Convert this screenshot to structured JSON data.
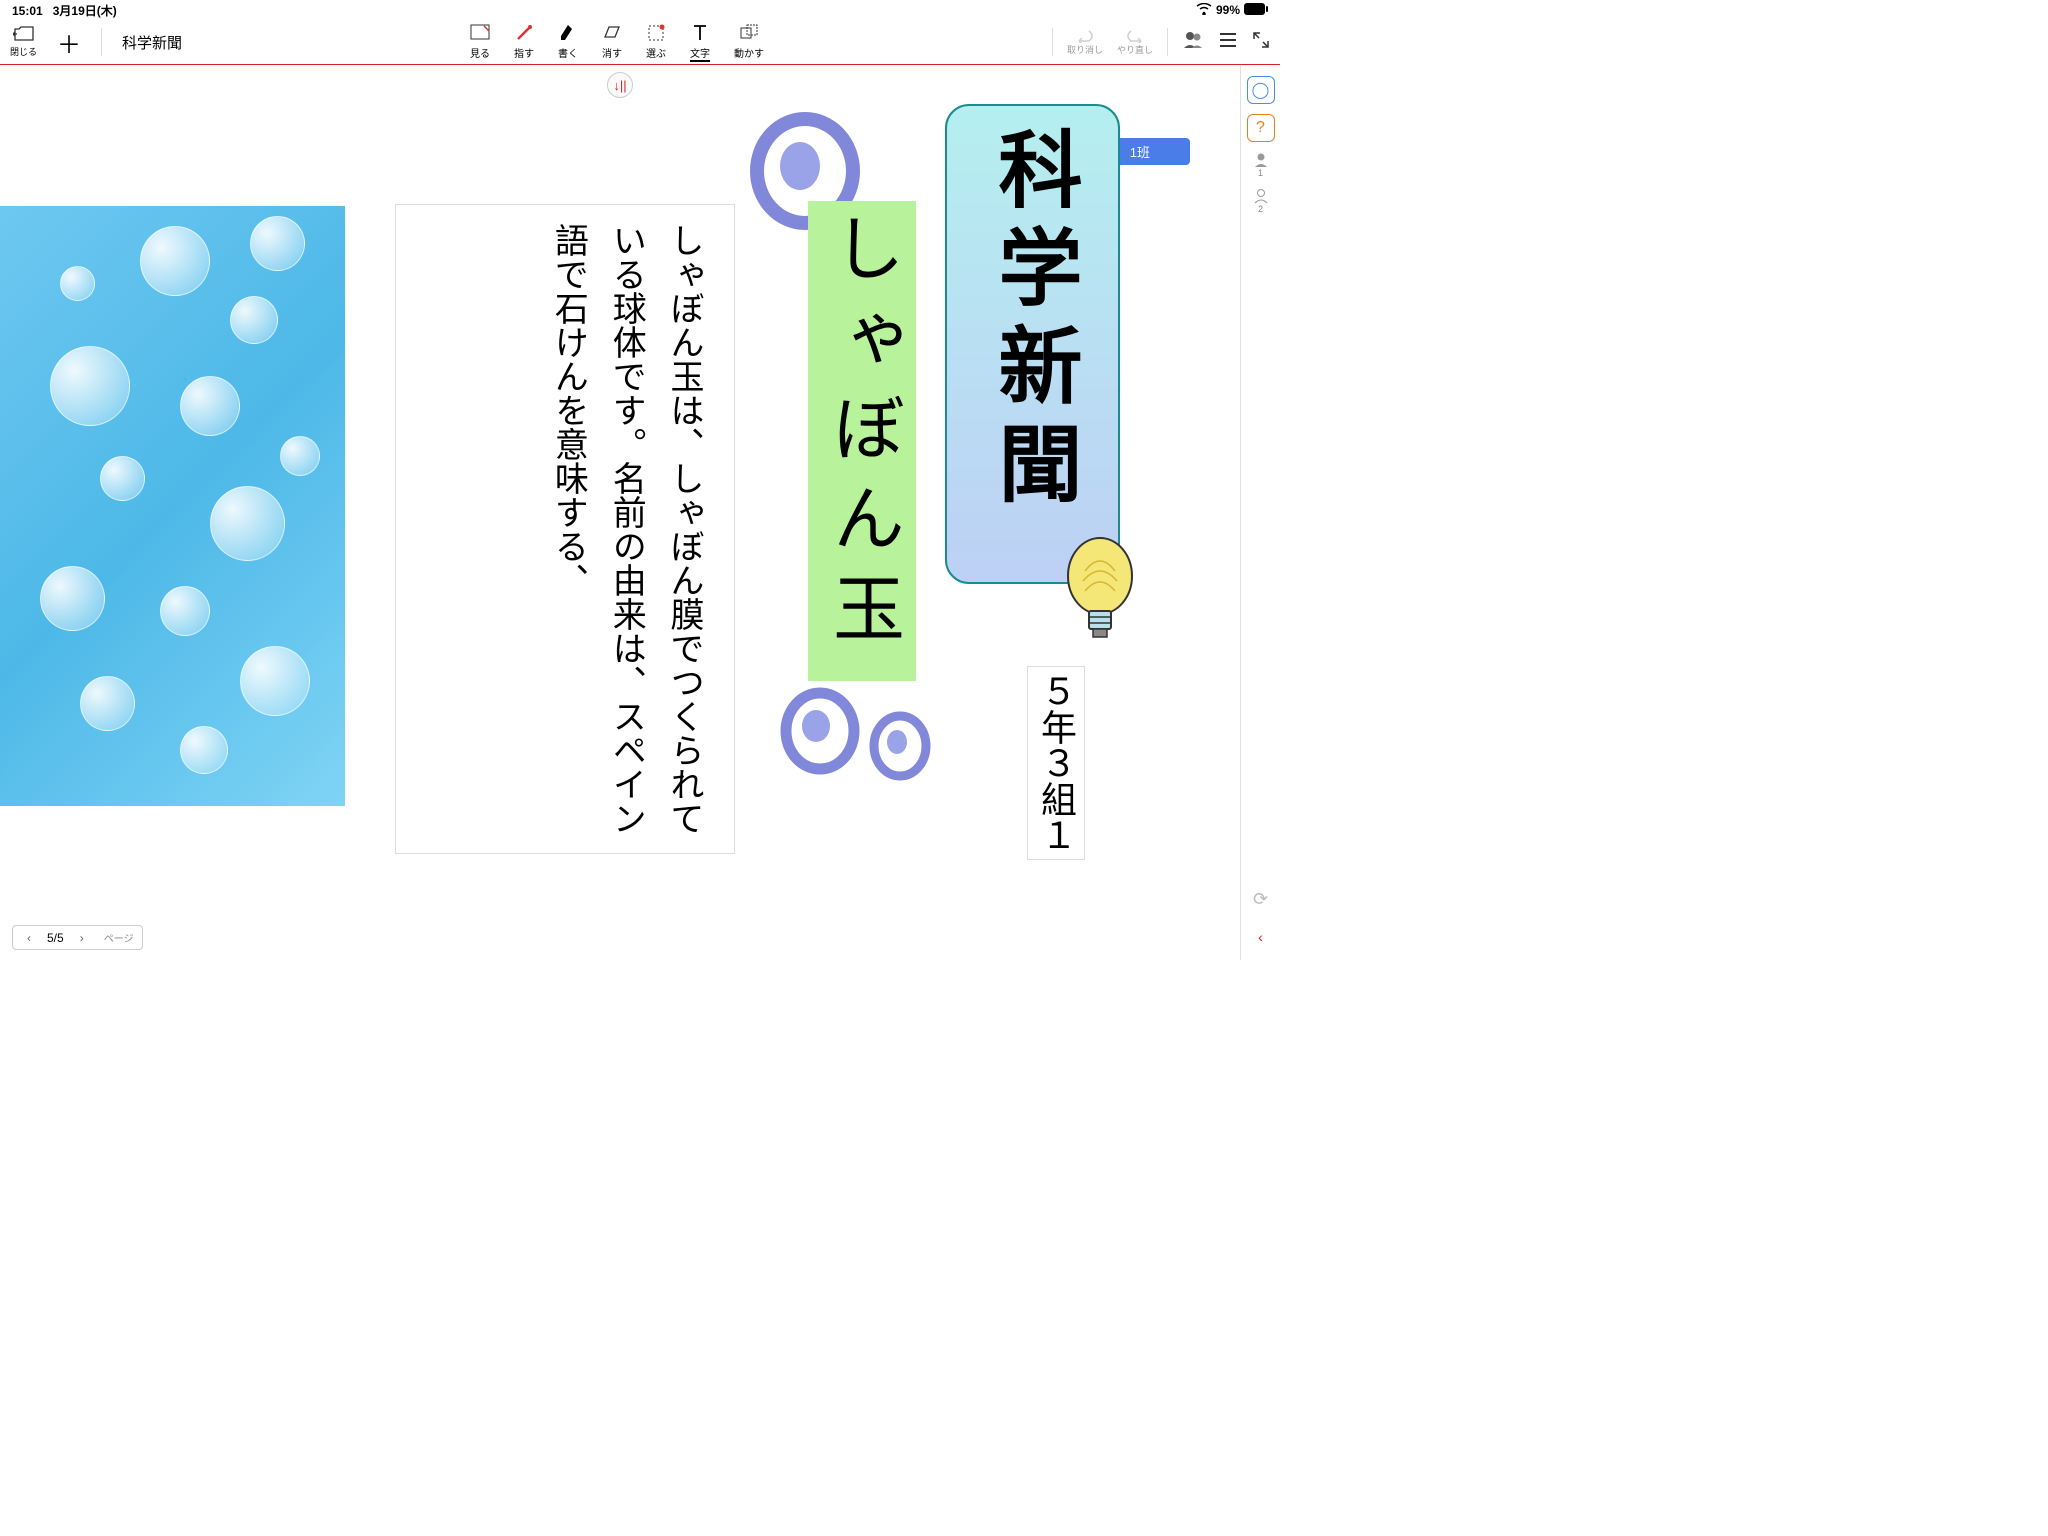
{
  "status": {
    "time": "15:01",
    "date": "3月19日(木)",
    "battery": "99%"
  },
  "toolbar": {
    "close_label": "閉じる",
    "doc_title": "科学新聞",
    "tools": [
      {
        "label": "見る"
      },
      {
        "label": "指す"
      },
      {
        "label": "書く"
      },
      {
        "label": "消す"
      },
      {
        "label": "選ぶ"
      },
      {
        "label": "文字"
      },
      {
        "label": "動かす"
      }
    ],
    "undo_label": "取り消し",
    "redo_label": "やり直し"
  },
  "group_badge": "1班",
  "right_panel": {
    "user1": "1",
    "user2": "2"
  },
  "canvas": {
    "direction_marker": "↓||",
    "title": "科学新聞",
    "class_info": "５年３組１",
    "subtitle": "しゃぼん玉",
    "body_text": "しゃぼん玉は、しゃぼん膜でつくられている球体です。名前の由来は、スペイン語で石けんを意味する、"
  },
  "pager": {
    "current": "5/5",
    "label": "ページ"
  }
}
